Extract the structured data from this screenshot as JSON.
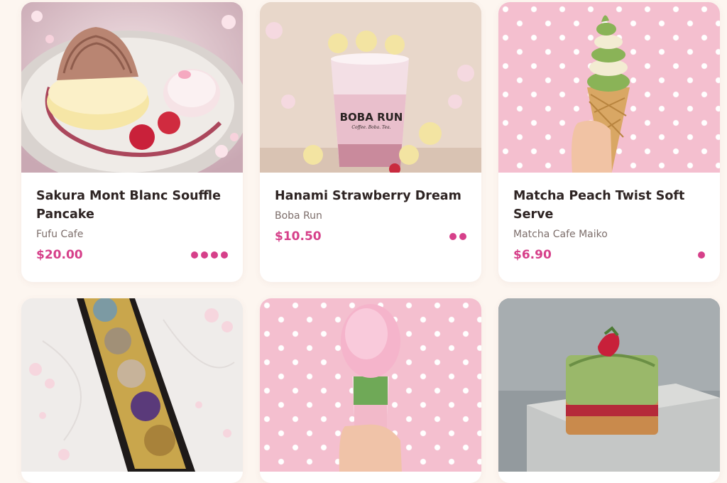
{
  "products": [
    {
      "name": "Sakura Mont Blanc Souffle Pancake",
      "vendor": "Fufu Cafe",
      "price": "$20.00",
      "dots": 4
    },
    {
      "name": "Hanami Strawberry Dream",
      "vendor": "Boba Run",
      "price": "$10.50",
      "dots": 2
    },
    {
      "name": "Matcha Peach Twist Soft Serve",
      "vendor": "Matcha Cafe Maiko",
      "price": "$6.90",
      "dots": 1
    }
  ],
  "boba_cup": {
    "brand": "BOBA RUN",
    "tagline": "Coffee. Boba. Tea."
  },
  "colors": {
    "accent": "#d6408a",
    "background": "#fdf6f0",
    "title": "#2e2423",
    "vendor": "#7d6e6b"
  },
  "bottom_images": [
    "sakura-chocolate-box",
    "pink-cotton-candy-drink",
    "matcha-strawberry-croissant-cube"
  ]
}
